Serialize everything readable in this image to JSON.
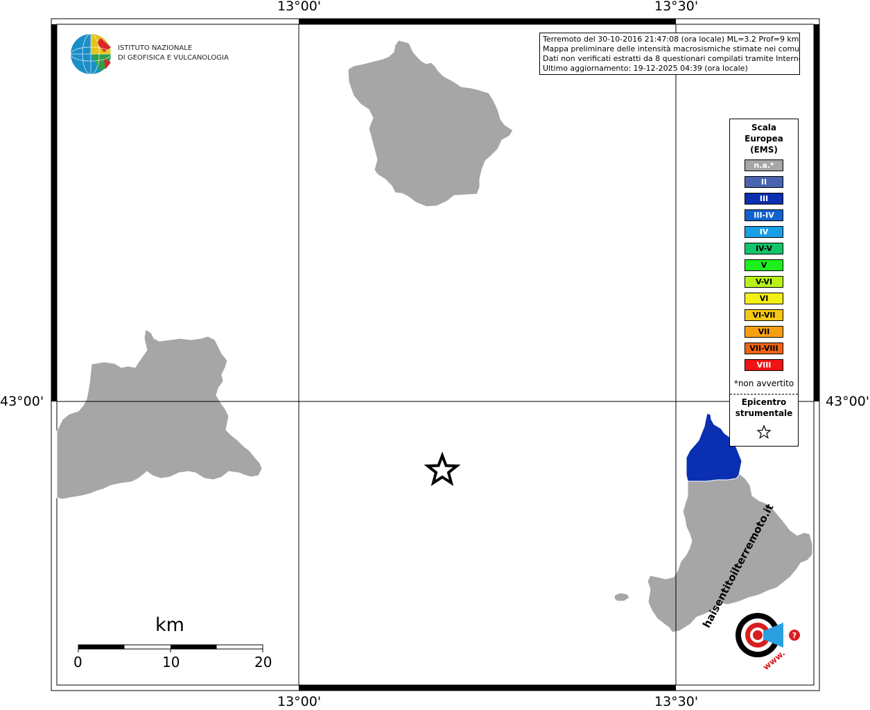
{
  "map": {
    "grid_labels": {
      "lon_west": "13°00'",
      "lon_east": "13°30'",
      "lat": "43°00'"
    }
  },
  "logo": {
    "line1": "ISTITUTO NAZIONALE",
    "line2": "DI GEOFISICA E VULCANOLOGIA"
  },
  "info": {
    "line1": "Terremoto del 30-10-2016 21:47:08 (ora locale) ML=3.2 Prof=9 km",
    "line2": "Mappa preliminare delle intensità macrosismiche stimate nei comuni",
    "line3": "Dati non verificati estratti da 8 questionari compilati tramite Internet.",
    "line4": "Ultimo aggiornamento: 19-12-2025 04:39 (ora locale)"
  },
  "legend": {
    "title_line1": "Scala",
    "title_line2": "Europea",
    "title_line3": "(EMS)",
    "items": [
      {
        "label": "n.a.*",
        "color": "#a6a6a6",
        "text_color": "#ffffff"
      },
      {
        "label": "II",
        "color": "#4a64b0",
        "text_color": "#ffffff"
      },
      {
        "label": "III",
        "color": "#0a2fb0",
        "text_color": "#ffffff"
      },
      {
        "label": "III-IV",
        "color": "#1262d0",
        "text_color": "#ffffff"
      },
      {
        "label": "IV",
        "color": "#1a9ee6",
        "text_color": "#ffffff"
      },
      {
        "label": "IV-V",
        "color": "#12c46a",
        "text_color": "#000000"
      },
      {
        "label": "V",
        "color": "#1ef01e",
        "text_color": "#000000"
      },
      {
        "label": "V-VI",
        "color": "#b8f01a",
        "text_color": "#000000"
      },
      {
        "label": "VI",
        "color": "#f5f014",
        "text_color": "#000000"
      },
      {
        "label": "VI-VII",
        "color": "#f5c814",
        "text_color": "#000000"
      },
      {
        "label": "VII",
        "color": "#f5a014",
        "text_color": "#000000"
      },
      {
        "label": "VII-VIII",
        "color": "#f06414",
        "text_color": "#000000"
      },
      {
        "label": "VIII",
        "color": "#f01414",
        "text_color": "#ffffff"
      }
    ],
    "note": "*non avvertito",
    "epicenter_line1": "Epicentro",
    "epicenter_line2": "strumentale"
  },
  "scale_bar": {
    "unit": "km",
    "ticks": [
      "0",
      "10",
      "20"
    ]
  },
  "colors": {
    "municipality_na": "#a6a6a6",
    "municipality_iii": "#0a2fb0"
  },
  "stamp": {
    "text": "haisentitoilterremoto.it",
    "www": "www."
  }
}
